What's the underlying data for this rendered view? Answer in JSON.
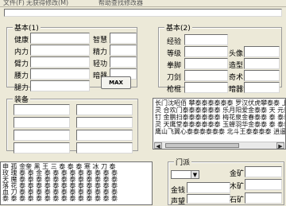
{
  "menu": [
    "文件(F)",
    "无获得修改(M)",
    "帮助查找修改器"
  ],
  "top_input": {
    "value": ""
  },
  "basic1": {
    "title": "基本(1)",
    "labels_left": [
      "健康",
      "内力",
      "臂力",
      "腰力",
      "腿力"
    ],
    "labels_right": [
      "智慧",
      "精力",
      "轻功",
      "暗器"
    ],
    "max_button": "MAX"
  },
  "basic2": {
    "title": "基本(2)",
    "labels_left": [
      "经验",
      "等级",
      "拳脚",
      "刀剑",
      "枪棍"
    ],
    "labels_right": [
      "头像",
      "造型",
      "奇术",
      "暗器"
    ]
  },
  "equipment": {
    "title": "装备"
  },
  "list_top": {
    "rows": [
      "长门沈昭佰 攀泰泰泰泰泰泰 罗汉伏虎攀泰泰 上天引王凋泰泰",
      "灵 合欢门泰泰泰泰泰泰 乐月阳爱金泰泰 天 元泰泰泰门泰泰",
      "钉 金鹏扫泰泰泰泰泰泰 梅花泉金春泰泰 泰 泰泰 泰泰泰泰泰",
      "灵 天鹰堂泰泰泰泰泰泰 玉蝉羽华金泰泰 泰 泰泰 泰泰泰泰泰",
      "鹰山飞翼心泰泰泰泰泰泰 北斗王泰泰泰泰 逍遥 泰泰 泰泰泰"
    ]
  },
  "list_bottom": {
    "rows": [
      "申 孤 金奎 黑 王 三 泰 泰 泰 寒 冰 刀 泰",
      "玫 瑰 泰 泰 金 泰 泰 泰 泰 泰 泰 泰 泰 泰",
      "天 魔 泰 泰 泰 泰 泰 泰 泰 泰 泰 泰 泰 泰",
      "落 花 泰 泰 泰 泰 泰 泰 泰 泰 泰 泰 泰 泰",
      "血 刀 泰 泰 泰 泰 泰 泰 泰 泰 泰 泰 泰 泰",
      "泰 泰 泰 泰 泰 泰 泰 泰 泰 泰 泰 泰 泰 泰"
    ]
  },
  "sect": {
    "title": "门派",
    "labels": [
      "金钱",
      "声望"
    ],
    "right_labels": [
      "金矿",
      "木矿",
      "石矿"
    ]
  }
}
